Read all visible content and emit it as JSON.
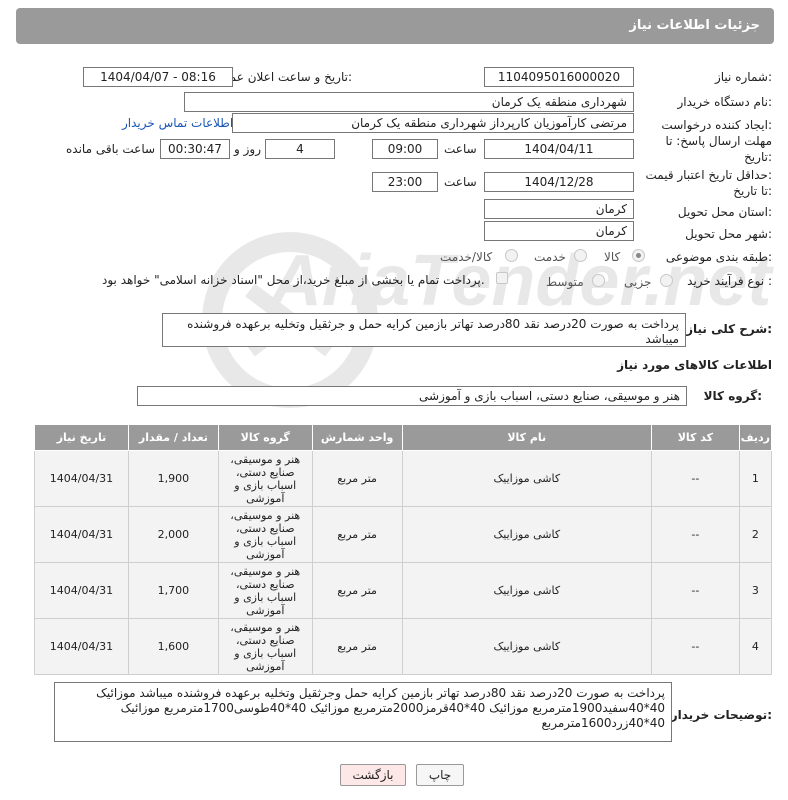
{
  "header": {
    "title": "جزئیات اطلاعات نیاز"
  },
  "form": {
    "need_number_label": "شماره نیاز:",
    "need_number": "1104095016000020",
    "announce_label": "تاریخ و ساعت اعلان عمومی:",
    "announce_value": "1404/04/07 - 08:16",
    "buyer_org_label": "نام دستگاه خریدار:",
    "buyer_org": "شهرداری منطقه یک کرمان",
    "creator_label": "ایجاد کننده درخواست:",
    "creator": "مرتضی کارآموزیان کارپرداز شهرداری منطقه یک کرمان",
    "contact_link": "اطلاعات تماس خریدار",
    "deadline_label_1": "مهلت ارسال پاسخ: تا",
    "deadline_label_2": "تاریخ:",
    "deadline_date": "1404/04/11",
    "time_label": "ساعت",
    "deadline_time": "09:00",
    "days_value": "4",
    "days_label": "روز و",
    "remaining_time": "00:30:47",
    "remaining_label": "ساعت باقی مانده",
    "validity_label_1": "حداقل تاریخ اعتبار قیمت:",
    "validity_label_2": "تا تاریخ:",
    "validity_date": "1404/12/28",
    "validity_time": "23:00",
    "province_label": "استان محل تحویل:",
    "province": "کرمان",
    "city_label": "شهر محل تحویل:",
    "city": "کرمان",
    "category_label": "طبقه بندی موضوعی:",
    "category_options": [
      "کالا",
      "خدمت",
      "کالا/خدمت"
    ],
    "category_selected": "کالا",
    "process_label": "نوع فرآیند خرید :",
    "process_options": [
      "جزیی",
      "متوسط"
    ],
    "process_note": "پرداخت تمام یا بخشی از مبلغ خرید،از محل \"اسناد خزانه اسلامی\" خواهد بود.",
    "summary_label": "شرح کلی نیاز:",
    "summary": "پرداخت به صورت 20درصد نقد 80درصد تهاتر  بازمین کرایه حمل و جرثقیل  وتخلیه برعهده فروشنده میباشد",
    "goods_info_title": "اطلاعات کالاهای مورد نیاز",
    "goods_group_label": "گروه کالا:",
    "goods_group": "هنر و موسیقی، صنایع دستی، اسباب بازی و آموزشی"
  },
  "table": {
    "headers": [
      "ردیف",
      "کد کالا",
      "نام کالا",
      "واحد شمارش",
      "گروه کالا",
      "تعداد / مقدار",
      "تاریخ نیاز"
    ],
    "rows": [
      {
        "row": "1",
        "code": "--",
        "name": "کاشی موزاییک",
        "unit": "متر مربع",
        "group": "هنر و موسیقی، صنایع دستی، اسباب بازی و آموزشی",
        "qty": "1,900",
        "date": "1404/04/31"
      },
      {
        "row": "2",
        "code": "--",
        "name": "کاشی موزاییک",
        "unit": "متر مربع",
        "group": "هنر و موسیقی، صنایع دستی، اسباب بازی و آموزشی",
        "qty": "2,000",
        "date": "1404/04/31"
      },
      {
        "row": "3",
        "code": "--",
        "name": "کاشی موزاییک",
        "unit": "متر مربع",
        "group": "هنر و موسیقی، صنایع دستی، اسباب بازی و آموزشی",
        "qty": "1,700",
        "date": "1404/04/31"
      },
      {
        "row": "4",
        "code": "--",
        "name": "کاشی موزاییک",
        "unit": "متر مربع",
        "group": "هنر و موسیقی، صنایع دستی، اسباب بازی و آموزشی",
        "qty": "1,600",
        "date": "1404/04/31"
      }
    ]
  },
  "buyer_notes": {
    "label": "توضیحات خریدار:",
    "text": "پرداخت به صورت 20درصد نقد 80درصد تهاتر  بازمین کرایه حمل  وجرثقیل وتخلیه برعهده فروشنده میباشد موزائیک 40*40سفید1900مترمربع موزائیک 40*40قرمز2000مترمربع موزائیک 40*40طوسی1700مترمربع موزائیک 40*40زرد1600مترمربع"
  },
  "buttons": {
    "print": "چاپ",
    "back": "بازگشت"
  },
  "watermark": {
    "text": "AriaTender.net"
  }
}
